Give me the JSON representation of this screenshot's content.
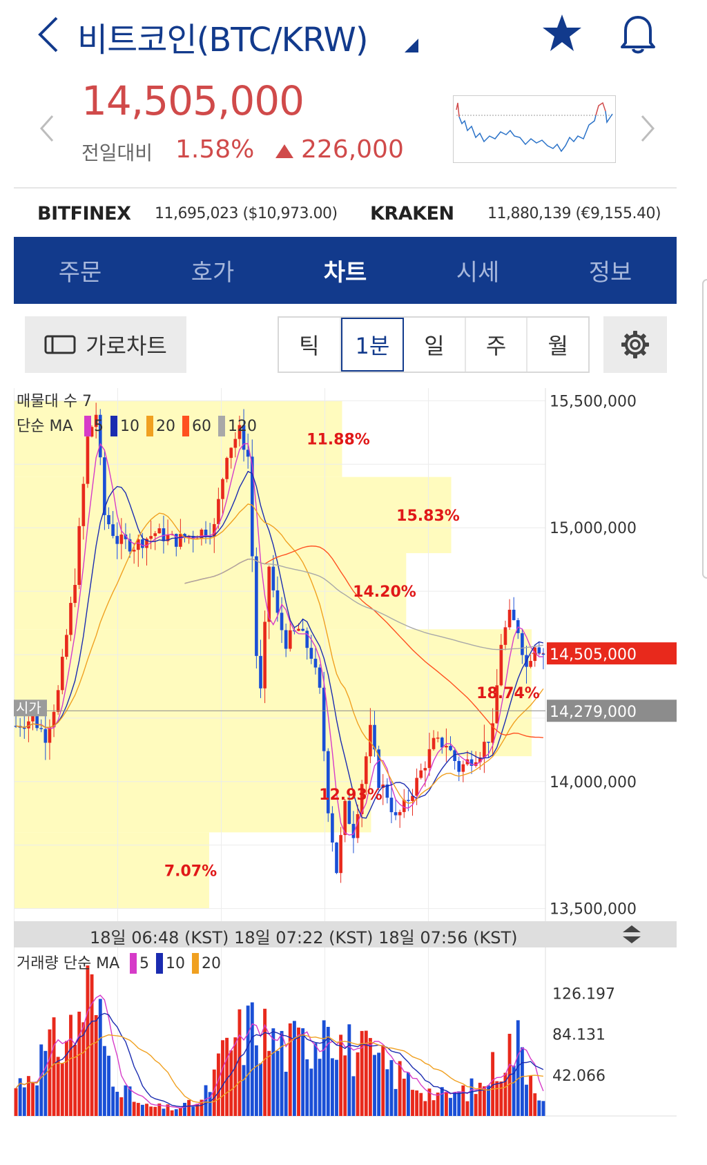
{
  "header": {
    "title": "비트코인(BTC/KRW)",
    "price": "14,505,000",
    "change_label": "전일대비",
    "change_pct": "1.58%",
    "change_amount": "226,000",
    "colors": {
      "up": "#d04a4a",
      "brand": "#123a8c"
    }
  },
  "exchanges": [
    {
      "name": "BITFINEX",
      "value": "11,695,023 ($10,973.00)"
    },
    {
      "name": "KRAKEN",
      "value": "11,880,139 (€9,155.40)"
    }
  ],
  "tabs": [
    {
      "label": "주문",
      "active": false
    },
    {
      "label": "호가",
      "active": false
    },
    {
      "label": "차트",
      "active": true
    },
    {
      "label": "시세",
      "active": false
    },
    {
      "label": "정보",
      "active": false
    }
  ],
  "toolbar": {
    "landscape_label": "가로차트",
    "periods": [
      {
        "label": "틱",
        "active": false
      },
      {
        "label": "1분",
        "active": true
      },
      {
        "label": "일",
        "active": false
      },
      {
        "label": "주",
        "active": false
      },
      {
        "label": "월",
        "active": false
      }
    ]
  },
  "icons": [
    "back-chevron-icon",
    "dropdown-caret-icon",
    "star-icon",
    "bell-icon",
    "prev-chevron-icon",
    "next-chevron-icon",
    "landscape-chart-icon",
    "gear-icon",
    "resize-handle-icon"
  ],
  "chart_data": [
    {
      "type": "candlestick",
      "legend_volume_profile": "매물대 수 7",
      "legend_ma_title": "단순 MA",
      "ma_periods": [
        "5",
        "10",
        "20",
        "60",
        "120"
      ],
      "ma_colors": [
        "#d63bc8",
        "#1a2bb0",
        "#f0a020",
        "#ff5020",
        "#a8a8a8"
      ],
      "y_ticks": [
        "15,500,000",
        "15,000,000",
        "14,000,000",
        "13,500,000"
      ],
      "y_tick_values": [
        15500000,
        15000000,
        14000000,
        13500000
      ],
      "ylim": [
        13450000,
        15550000
      ],
      "current_price": {
        "label": "14,505,000",
        "value": 14505000
      },
      "open_line": {
        "label": "14,279,000",
        "value": 14279000,
        "tag": "시가"
      },
      "volume_profile": [
        {
          "from": 15200000,
          "to": 15500000,
          "pct": 11.88,
          "label": "11.88%"
        },
        {
          "from": 14900000,
          "to": 15200000,
          "pct": 15.83,
          "label": "15.83%"
        },
        {
          "from": 14600000,
          "to": 14900000,
          "pct": 14.2,
          "label": "14.20%"
        },
        {
          "from": 14100000,
          "to": 14600000,
          "pct": 18.74,
          "label": "18.74%"
        },
        {
          "from": 13800000,
          "to": 14100000,
          "pct": 12.93,
          "label": "12.93%"
        },
        {
          "from": 13500000,
          "to": 13800000,
          "pct": 7.07,
          "label": "7.07%"
        }
      ],
      "x_labels": [
        "18일 06:48 (KST)",
        "18일 07:22 (KST)",
        "18일 07:56 (KST)"
      ],
      "price_keypoints": [
        [
          0,
          14220000
        ],
        [
          4,
          14250000
        ],
        [
          7,
          14180000
        ],
        [
          10,
          14350000
        ],
        [
          14,
          14800000
        ],
        [
          17,
          15350000
        ],
        [
          19,
          15450000
        ],
        [
          21,
          15050000
        ],
        [
          24,
          14950000
        ],
        [
          28,
          14930000
        ],
        [
          33,
          14980000
        ],
        [
          38,
          14950000
        ],
        [
          43,
          14980000
        ],
        [
          47,
          15000000
        ],
        [
          50,
          15300000
        ],
        [
          53,
          15380000
        ],
        [
          55,
          15280000
        ],
        [
          57,
          14500000
        ],
        [
          58,
          14350000
        ],
        [
          60,
          14850000
        ],
        [
          62,
          14650000
        ],
        [
          64,
          14550000
        ],
        [
          67,
          14600000
        ],
        [
          70,
          14500000
        ],
        [
          72,
          14350000
        ],
        [
          74,
          13900000
        ],
        [
          76,
          13650000
        ],
        [
          78,
          13900000
        ],
        [
          80,
          13800000
        ],
        [
          82,
          14000000
        ],
        [
          84,
          14200000
        ],
        [
          86,
          14000000
        ],
        [
          88,
          13950000
        ],
        [
          90,
          13850000
        ],
        [
          92,
          13900000
        ],
        [
          95,
          14000000
        ],
        [
          99,
          14150000
        ],
        [
          102,
          14150000
        ],
        [
          105,
          14050000
        ],
        [
          110,
          14120000
        ],
        [
          113,
          14200000
        ],
        [
          115,
          14550000
        ],
        [
          117,
          14650000
        ],
        [
          119,
          14600000
        ],
        [
          121,
          14450000
        ],
        [
          123,
          14550000
        ],
        [
          125,
          14505000
        ]
      ]
    },
    {
      "type": "volume",
      "legend_title": "거래량 단순 MA",
      "ma_periods": [
        "5",
        "10",
        "20"
      ],
      "ma_colors": [
        "#d63bc8",
        "#1a2bb0",
        "#f0a020"
      ],
      "y_ticks": [
        "126.197",
        "84.131",
        "42.066"
      ],
      "y_tick_values": [
        126.197,
        84.131,
        42.066
      ],
      "ylim": [
        0,
        165
      ],
      "volume_keypoints": [
        [
          0,
          30
        ],
        [
          5,
          55
        ],
        [
          10,
          75
        ],
        [
          14,
          90
        ],
        [
          17,
          130
        ],
        [
          19,
          110
        ],
        [
          22,
          60
        ],
        [
          26,
          25
        ],
        [
          30,
          10
        ],
        [
          38,
          8
        ],
        [
          44,
          15
        ],
        [
          47,
          40
        ],
        [
          50,
          70
        ],
        [
          54,
          85
        ],
        [
          57,
          95
        ],
        [
          60,
          80
        ],
        [
          64,
          70
        ],
        [
          68,
          75
        ],
        [
          72,
          90
        ],
        [
          74,
          130
        ],
        [
          76,
          80
        ],
        [
          79,
          70
        ],
        [
          82,
          65
        ],
        [
          86,
          55
        ],
        [
          90,
          45
        ],
        [
          94,
          35
        ],
        [
          98,
          25
        ],
        [
          102,
          20
        ],
        [
          106,
          25
        ],
        [
          110,
          30
        ],
        [
          114,
          55
        ],
        [
          117,
          70
        ],
        [
          119,
          75
        ],
        [
          121,
          55
        ],
        [
          123,
          35
        ],
        [
          125,
          20
        ]
      ]
    }
  ]
}
